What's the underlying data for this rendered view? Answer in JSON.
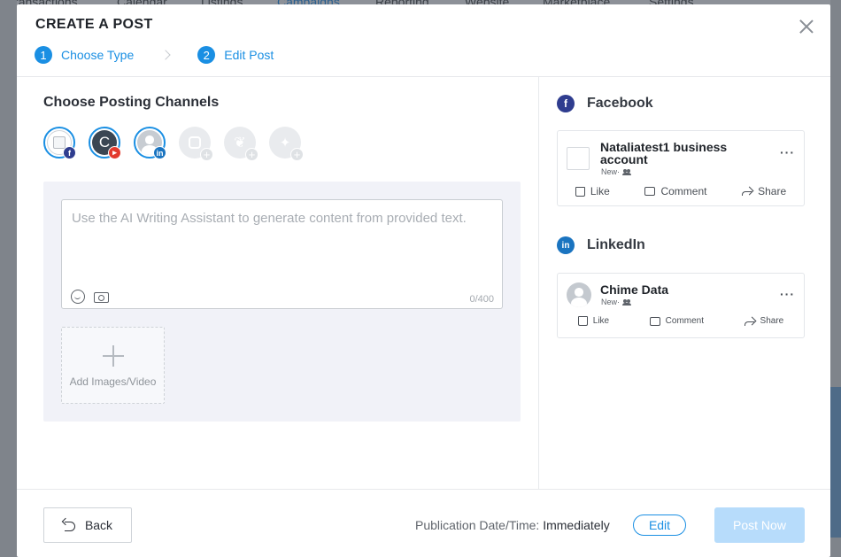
{
  "background": {
    "nav_items": [
      "Transactions",
      "Calendar",
      "Listings",
      "Campaigns",
      "Reporting",
      "Website",
      "Marketplace",
      "Settings"
    ]
  },
  "modal": {
    "title": "CREATE A POST",
    "steps": [
      {
        "number": "1",
        "label": "Choose Type"
      },
      {
        "number": "2",
        "label": "Edit Post"
      }
    ]
  },
  "compose": {
    "section_title": "Choose Posting Channels",
    "channels": [
      {
        "name": "facebook",
        "selected": true
      },
      {
        "name": "youtube",
        "initial": "C",
        "selected": true
      },
      {
        "name": "linkedin",
        "selected": true
      },
      {
        "name": "instagram",
        "selected": false
      },
      {
        "name": "twitter",
        "selected": false
      },
      {
        "name": "google",
        "selected": false
      }
    ],
    "textarea_placeholder": "Use the AI Writing Assistant to generate content from provided text.",
    "char_count": "0/400",
    "add_media_label": "Add Images/Video"
  },
  "preview": {
    "facebook": {
      "network_label": "Facebook",
      "account_name": "Nataliatest1 business account",
      "meta": "New·",
      "actions": [
        "Like",
        "Comment",
        "Share"
      ]
    },
    "linkedin": {
      "network_label": "LinkedIn",
      "account_name": "Chime Data",
      "meta": "New·",
      "actions": [
        "Like",
        "Comment",
        "Share"
      ]
    }
  },
  "footer": {
    "back_label": "Back",
    "publication_label": "Publication Date/Time:",
    "publication_value": "Immediately",
    "edit_label": "Edit",
    "post_label": "Post Now"
  },
  "colors": {
    "accent": "#1a8fe3",
    "facebook": "#2f3d8f",
    "youtube": "#e23a2e",
    "linkedin": "#1a74c0",
    "post_disabled": "#b7dcfb"
  }
}
